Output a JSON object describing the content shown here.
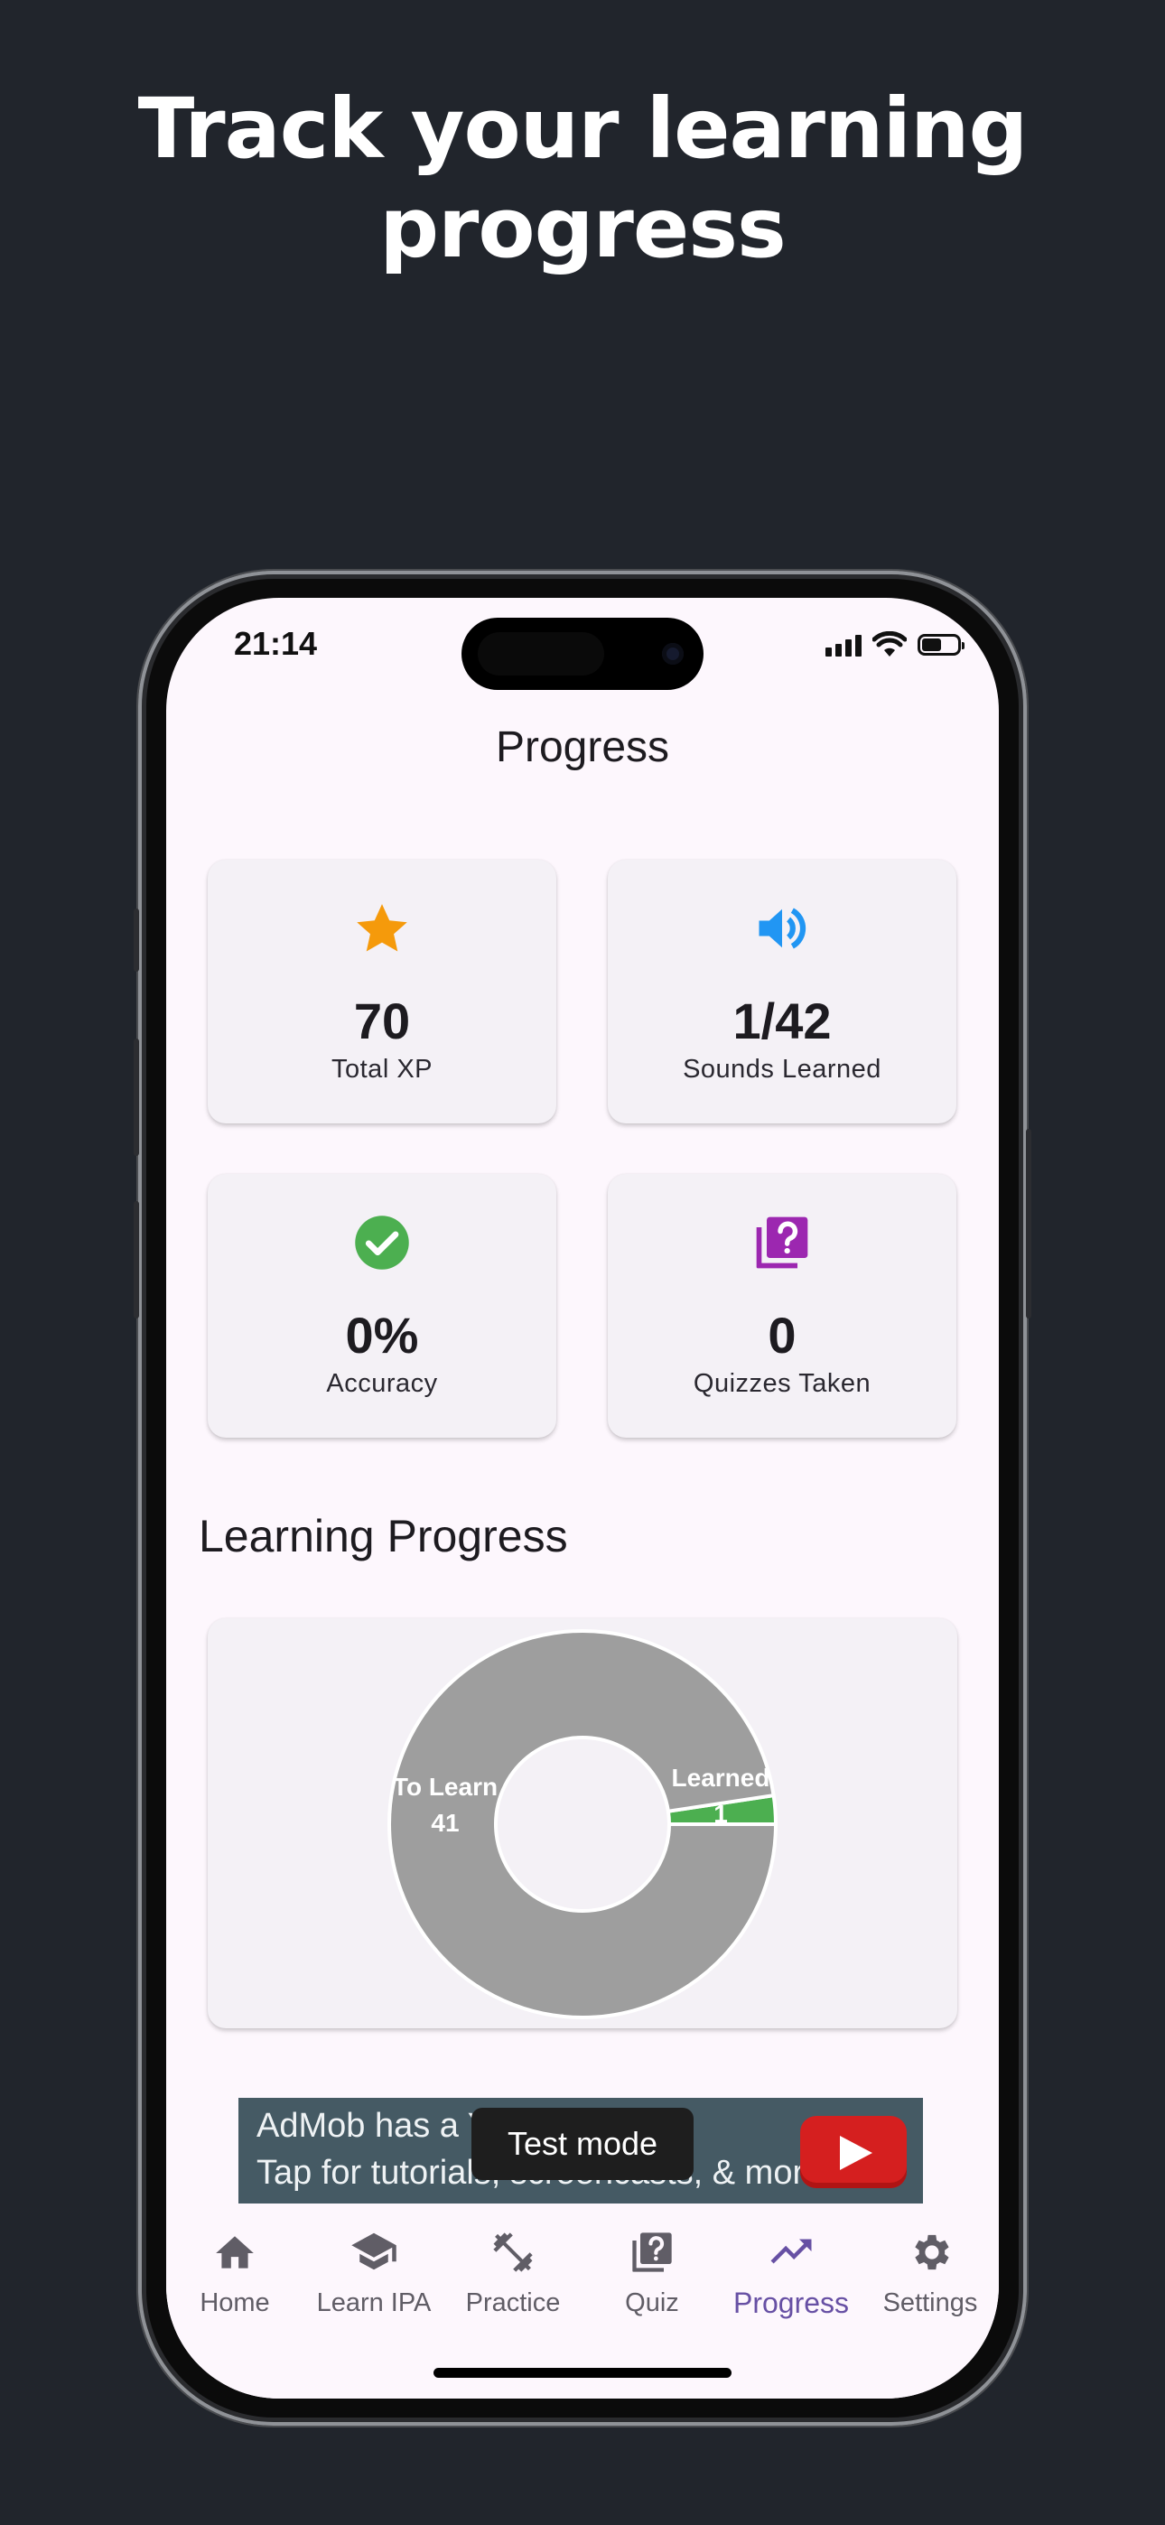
{
  "headline": {
    "line1": "Track your learning",
    "line2": "progress"
  },
  "status_bar": {
    "time": "21:14"
  },
  "page_title": "Progress",
  "stats": [
    {
      "icon": "star-icon",
      "value": "70",
      "label": "Total XP",
      "color": "#f59a0b"
    },
    {
      "icon": "volume-icon",
      "value": "1/42",
      "label": "Sounds Learned",
      "color": "#2196f3"
    },
    {
      "icon": "check-circle-icon",
      "value": "0%",
      "label": "Accuracy",
      "color": "#4caf50"
    },
    {
      "icon": "quiz-icon",
      "value": "0",
      "label": "Quizzes Taken",
      "color": "#9c27b0"
    }
  ],
  "section_title": "Learning Progress",
  "chart_data": {
    "type": "pie",
    "variant": "donut",
    "slices": [
      {
        "label": "To Learn",
        "value": 41,
        "color": "#9e9e9e"
      },
      {
        "label": "Learned",
        "value": 1,
        "color": "#4caf50"
      }
    ]
  },
  "ad": {
    "line1": "AdMob has a Yo",
    "line2": "Tap for tutorials, screencasts, & more.",
    "toast": "Test mode"
  },
  "nav": [
    {
      "label": "Home",
      "icon": "home-icon",
      "active": false
    },
    {
      "label": "Learn IPA",
      "icon": "school-icon",
      "active": false
    },
    {
      "label": "Practice",
      "icon": "dumbbell-icon",
      "active": false
    },
    {
      "label": "Quiz",
      "icon": "quiz-icon",
      "active": false
    },
    {
      "label": "Progress",
      "icon": "trending-up-icon",
      "active": true
    },
    {
      "label": "Settings",
      "icon": "gear-icon",
      "active": false
    }
  ],
  "colors": {
    "accent": "#6750a4",
    "background": "#21252c",
    "screen": "#fdf7fd"
  }
}
